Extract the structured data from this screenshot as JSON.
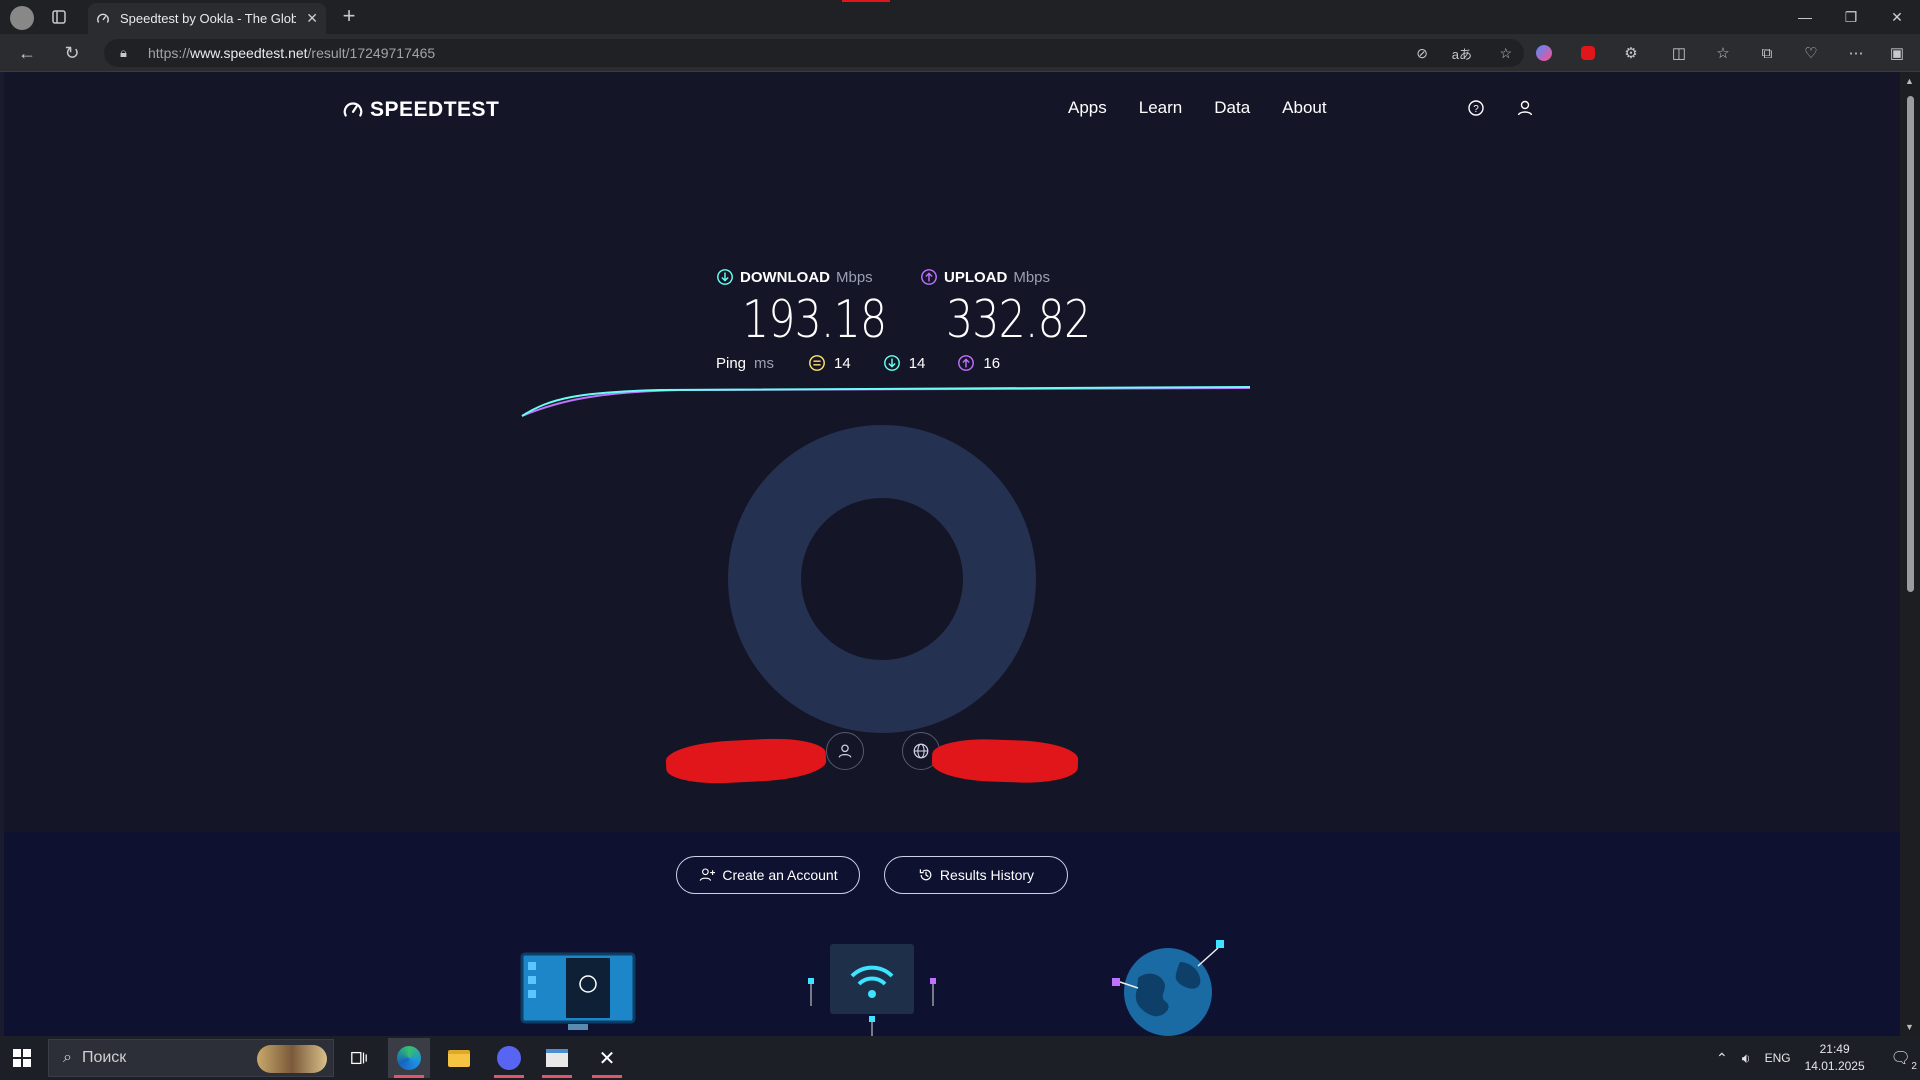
{
  "browser": {
    "tab_title": "Speedtest by Ookla - The Global I",
    "url_prefix": "https://",
    "url_host": "www.speedtest.net",
    "url_path": "/result/17249717465"
  },
  "site": {
    "logo_text": "SPEEDTEST",
    "nav": [
      "Apps",
      "Learn",
      "Data",
      "About"
    ]
  },
  "result": {
    "download": {
      "label": "DOWNLOAD",
      "unit": "Mbps",
      "value": "193.18"
    },
    "upload": {
      "label": "UPLOAD",
      "unit": "Mbps",
      "value": "332.82"
    },
    "ping": {
      "label": "Ping",
      "unit": "ms",
      "idle": "14",
      "down": "14",
      "up": "16"
    }
  },
  "buttons": {
    "create_account": "Create an Account",
    "results_history": "Results History"
  },
  "taskbar": {
    "search_placeholder": "Поиск",
    "lang": "ENG",
    "time": "21:49",
    "date": "14.01.2025",
    "notif_count": "2"
  },
  "colors": {
    "download_accent": "#6afff3",
    "upload_accent": "#bf71ff",
    "ping_accent": "#ffe36b",
    "ring": "#253150"
  }
}
